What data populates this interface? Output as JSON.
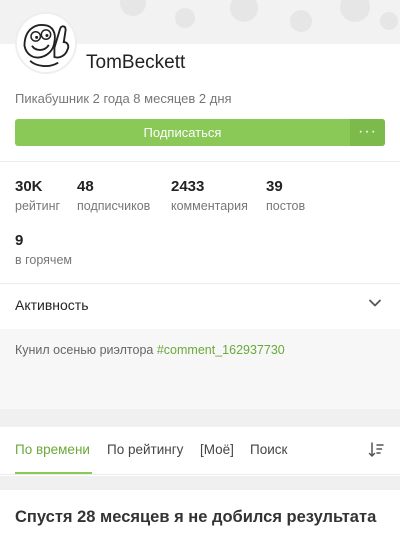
{
  "profile": {
    "username": "TomBeckett",
    "member_since": "Пикабушник 2 года 8 месяцев 2 дня"
  },
  "subscribe": {
    "label": "Подписаться",
    "more": "···"
  },
  "stats": [
    {
      "value": "30K",
      "label": "рейтинг"
    },
    {
      "value": "48",
      "label": "подписчиков"
    },
    {
      "value": "2433",
      "label": "комментария"
    },
    {
      "value": "39",
      "label": "постов"
    },
    {
      "value": "9",
      "label": "в горячем"
    }
  ],
  "activity": {
    "title": "Активность",
    "text": "Кунил осенью риэлтора ",
    "link": "#comment_162937730"
  },
  "tabs": [
    {
      "label": "По времени",
      "active": true
    },
    {
      "label": "По рейтингу",
      "active": false
    },
    {
      "label": "[Моё]",
      "active": false
    },
    {
      "label": "Поиск",
      "active": false
    }
  ],
  "post": {
    "title": "Спустя 28 месяцев я не добился результата"
  },
  "colors": {
    "accent": "#8ac858",
    "link": "#6aa93a"
  },
  "icons": [
    "avatar-rage-face",
    "more-dots-icon",
    "chevron-down-icon",
    "sort-icon"
  ]
}
